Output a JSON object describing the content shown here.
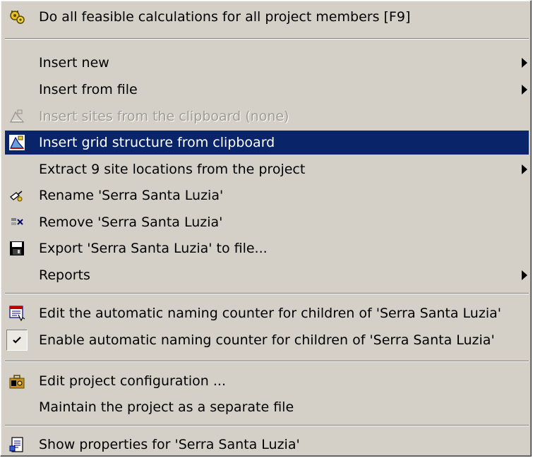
{
  "menu": {
    "items": [
      {
        "label": "Do all feasible calculations for all project members [F9]",
        "icon": "gear-calculate-icon",
        "submenu": false,
        "enabled": true
      },
      {
        "label": "Insert new",
        "icon": null,
        "submenu": true,
        "enabled": true
      },
      {
        "label": "Insert from file",
        "icon": null,
        "submenu": true,
        "enabled": true
      },
      {
        "label": "Insert sites from the clipboard (none)",
        "icon": "insert-sites-clipboard-icon",
        "submenu": false,
        "enabled": false
      },
      {
        "label": "Insert grid structure from clipboard",
        "icon": "insert-grid-clipboard-icon",
        "submenu": false,
        "enabled": true,
        "highlighted": true
      },
      {
        "label": "Extract 9 site locations from the project",
        "icon": null,
        "submenu": true,
        "enabled": true
      },
      {
        "label": "Rename 'Serra Santa Luzia'",
        "icon": "rename-icon",
        "submenu": false,
        "enabled": true
      },
      {
        "label": "Remove 'Serra Santa Luzia'",
        "icon": "remove-icon",
        "submenu": false,
        "enabled": true
      },
      {
        "label": "Export 'Serra Santa Luzia' to file...",
        "icon": "export-save-icon",
        "submenu": false,
        "enabled": true
      },
      {
        "label": "Reports",
        "icon": null,
        "submenu": true,
        "enabled": true
      },
      {
        "label": "Edit the automatic naming counter for children of 'Serra Santa Luzia'",
        "icon": "naming-counter-icon",
        "submenu": false,
        "enabled": true
      },
      {
        "label": "Enable automatic naming counter for children of 'Serra Santa Luzia'",
        "icon": "check-icon",
        "submenu": false,
        "enabled": true,
        "checked": true
      },
      {
        "label": "Edit project configuration ...",
        "icon": "project-config-icon",
        "submenu": false,
        "enabled": true
      },
      {
        "label": "Maintain the project as a separate file",
        "icon": null,
        "submenu": false,
        "enabled": true
      },
      {
        "label": "Show properties for 'Serra Santa Luzia'",
        "icon": "properties-icon",
        "submenu": false,
        "enabled": true
      }
    ]
  },
  "colors": {
    "menu_bg": "#d4d0c8",
    "highlight": "#0a246a",
    "disabled_text": "#a09c94"
  }
}
